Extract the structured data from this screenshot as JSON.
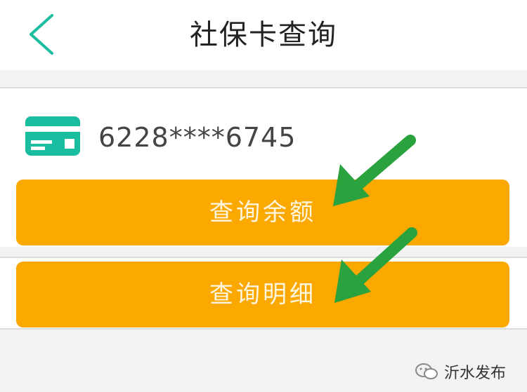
{
  "header": {
    "title": "社保卡查询",
    "back_icon": "chevron-left-icon"
  },
  "card": {
    "icon": "card-icon",
    "number": "6228****6745"
  },
  "actions": {
    "balance_label": "查询余额",
    "details_label": "查询明细"
  },
  "annotations": {
    "arrow_icon": "arrow-down-left-icon",
    "arrow_color": "#2aa33f"
  },
  "watermark": {
    "icon": "wechat-icon",
    "text": "沂水发布"
  },
  "colors": {
    "accent": "#1bbda0",
    "button": "#fba800",
    "background": "#f2f2f2"
  }
}
